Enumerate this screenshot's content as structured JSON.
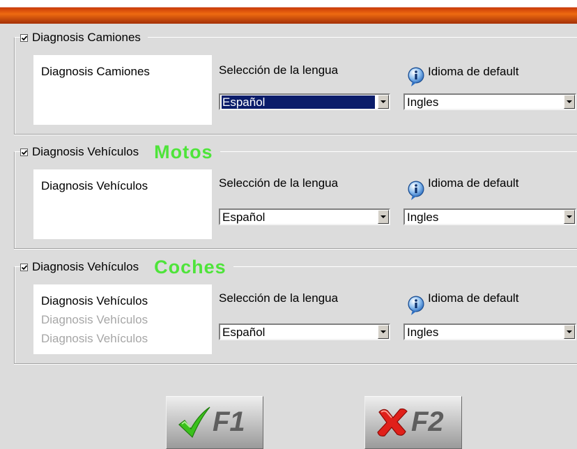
{
  "window": {
    "title": ""
  },
  "groups": [
    {
      "title": "Diagnosis Camiones",
      "accent_label": "",
      "checked": true,
      "list_items": [
        {
          "text": "Diagnosis Camiones",
          "enabled": true
        }
      ],
      "language_label": "Selección de la lengua",
      "language_value": "Español",
      "language_selected": true,
      "default_label": "Idioma de default",
      "default_value": "Ingles"
    },
    {
      "title": "Diagnosis Vehículos",
      "accent_label": "Motos",
      "checked": true,
      "list_items": [
        {
          "text": "Diagnosis Vehículos",
          "enabled": true
        }
      ],
      "language_label": "Selección de la lengua",
      "language_value": "Español",
      "language_selected": false,
      "default_label": "Idioma de default",
      "default_value": "Ingles"
    },
    {
      "title": "Diagnosis Vehículos",
      "accent_label": "Coches",
      "checked": true,
      "list_items": [
        {
          "text": "Diagnosis Vehículos",
          "enabled": true
        },
        {
          "text": "Diagnosis Vehículos",
          "enabled": false
        },
        {
          "text": "Diagnosis Vehículos",
          "enabled": false
        }
      ],
      "language_label": "Selección de la lengua",
      "language_value": "Español",
      "language_selected": false,
      "default_label": "Idioma de default",
      "default_value": "Ingles"
    }
  ],
  "buttons": {
    "confirm": {
      "key": "F1",
      "icon": "green-checkmark-icon"
    },
    "cancel": {
      "key": "F2",
      "icon": "red-x-icon"
    }
  },
  "colors": {
    "accent_green": "#4ee43a",
    "selection_blue": "#0a1c6a",
    "titlebar_orange": "#ee6a10",
    "check_green": "#3bc11c",
    "cancel_red": "#e0201a",
    "info_blue": "#2f6fc0"
  }
}
